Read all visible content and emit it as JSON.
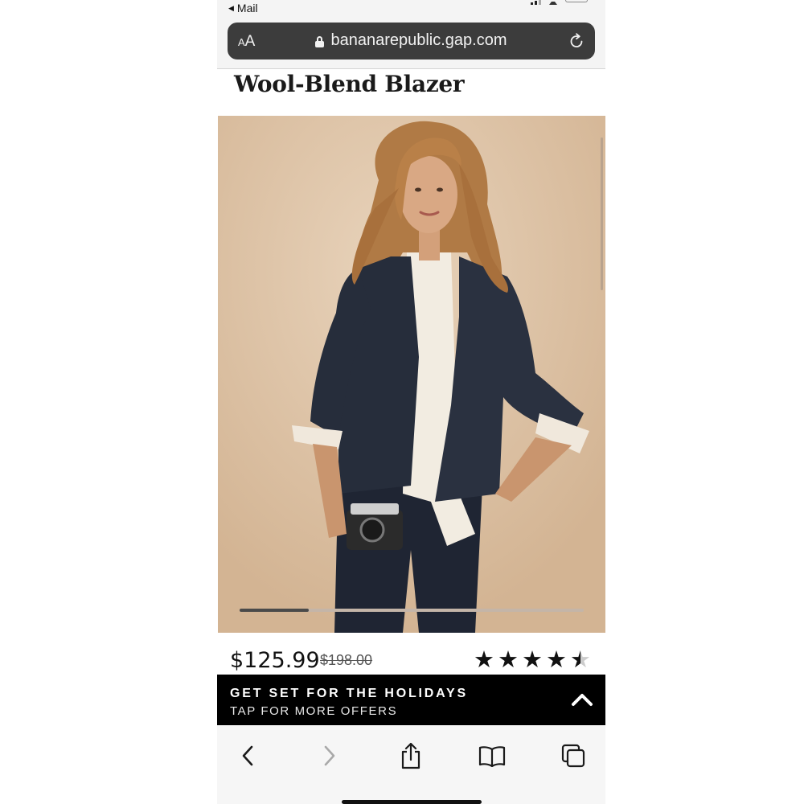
{
  "status_bar": {
    "back_app_label": "Mail",
    "back_arrow_glyph": "◀"
  },
  "address_bar": {
    "text_size_small": "A",
    "text_size_large": "A",
    "url": "bananarepublic.gap.com",
    "icons": [
      "lock-icon",
      "reload-icon"
    ]
  },
  "product": {
    "title": "Wool-Blend Blazer",
    "image_carousel_progress": 0.2,
    "sale_price": "$125.99",
    "original_price": "$198.00",
    "rating": 4.5,
    "rating_max": 5
  },
  "promo": {
    "headline": "GET SET FOR THE HOLIDAYS",
    "subline": "TAP FOR MORE OFFERS",
    "icon": "chevron-up-icon"
  },
  "toolbar": {
    "icons": [
      "back-icon",
      "forward-icon",
      "share-icon",
      "bookmarks-icon",
      "tabs-icon"
    ],
    "forward_enabled": false
  },
  "colors": {
    "url_bar_bg": "#3c3c3c",
    "promo_bg": "#000000",
    "toolbar_icon": "#1a6fd8",
    "toolbar_icon_disabled": "#a9a9a9",
    "photo_bg": "#dcbe9f"
  }
}
